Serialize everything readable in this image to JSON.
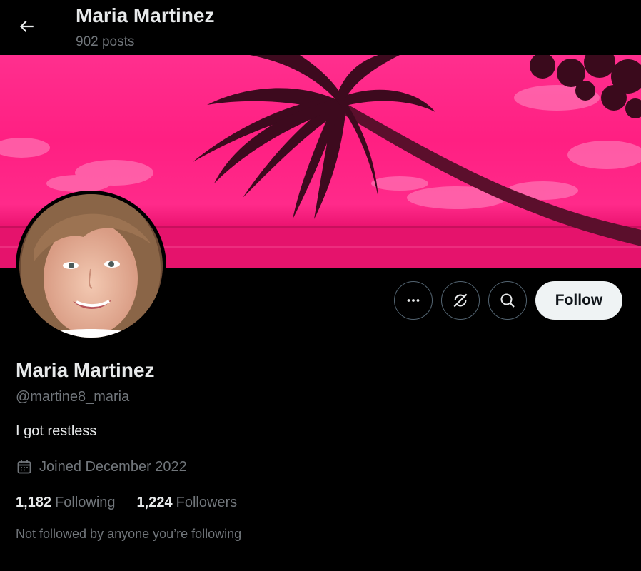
{
  "header": {
    "title": "Maria Martinez",
    "post_count": "902 posts",
    "back_icon": "arrow-left-icon"
  },
  "colors": {
    "background": "#000000",
    "text_primary": "#e7e9ea",
    "text_secondary": "#71767b",
    "follow_bg": "#eff3f4",
    "follow_text": "#0f1419",
    "banner_pink": "#ff2a8a",
    "button_border": "#536471"
  },
  "actions": {
    "more_icon": "more-horizontal-icon",
    "grok_icon": "grok-icon",
    "search_icon": "search-icon",
    "follow_label": "Follow"
  },
  "profile": {
    "display_name": "Maria Martinez",
    "handle": "@martine8_maria",
    "bio": "I got restless",
    "joined_icon": "calendar-icon",
    "joined": "Joined December 2022",
    "following_count": "1,182",
    "following_label": "Following",
    "followers_count": "1,224",
    "followers_label": "Followers",
    "mutuals_text": "Not followed by anyone you’re following"
  }
}
